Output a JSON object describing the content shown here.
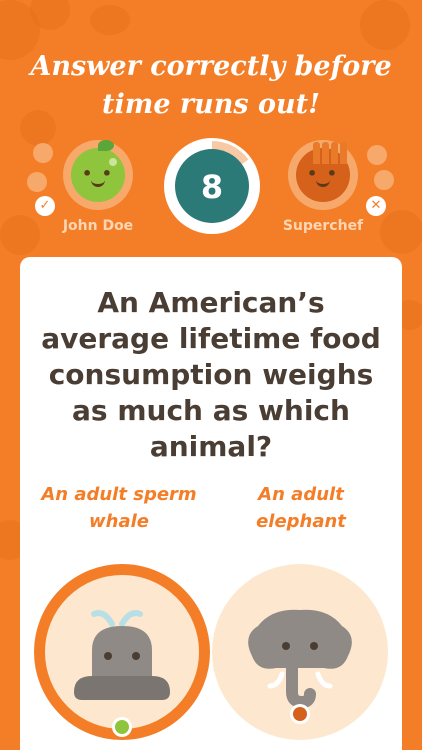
{
  "headline": "Answer correctly before time runs out!",
  "players": {
    "left": {
      "name": "John Doe",
      "status_icon": "check-icon",
      "avatar": "pea-avatar-icon"
    },
    "right": {
      "name": "Superchef",
      "status_icon": "x-icon",
      "avatar": "fries-avatar-icon"
    }
  },
  "timer": {
    "seconds": "8",
    "remaining_fraction": 0.85,
    "color": "#2b7a78"
  },
  "question": "An American’s average lifetime food consumption weighs as much as which animal?",
  "answers": [
    {
      "label": "An adult sperm whale",
      "icon": "whale-icon",
      "selected": true,
      "picked_by": "John Doe"
    },
    {
      "label": "An adult elephant",
      "icon": "elephant-icon",
      "selected": false,
      "picked_by": "Superchef"
    }
  ],
  "colors": {
    "background": "#f47e27",
    "card": "#ffffff",
    "accent": "#f47e27",
    "text": "#4a3d33"
  }
}
